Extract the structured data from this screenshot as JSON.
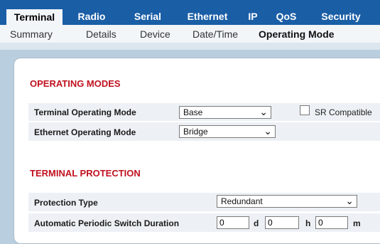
{
  "main_tabs": [
    "Terminal",
    "Radio",
    "Serial",
    "Ethernet",
    "IP",
    "QoS",
    "Security"
  ],
  "sub_tabs": [
    "Summary",
    "Details",
    "Device",
    "Date/Time",
    "Operating Mode"
  ],
  "operating_modes": {
    "title": "OPERATING MODES",
    "terminal_mode_label": "Terminal Operating Mode",
    "terminal_mode_value": "Base",
    "sr_compatible_label": "SR Compatible",
    "ethernet_mode_label": "Ethernet Operating Mode",
    "ethernet_mode_value": "Bridge"
  },
  "terminal_protection": {
    "title": "TERMINAL PROTECTION",
    "protection_type_label": "Protection Type",
    "protection_type_value": "Redundant",
    "switch_duration_label": "Automatic Periodic Switch Duration",
    "days_value": "0",
    "days_unit": "d",
    "hours_value": "0",
    "hours_unit": "h",
    "minutes_value": "0",
    "minutes_unit": "m"
  },
  "colors": {
    "nav_blue": "#1a5ea6",
    "section_red": "#c0111f",
    "background": "#b9cfe0"
  },
  "icons": {
    "dropdown": "chevron-down-icon"
  }
}
